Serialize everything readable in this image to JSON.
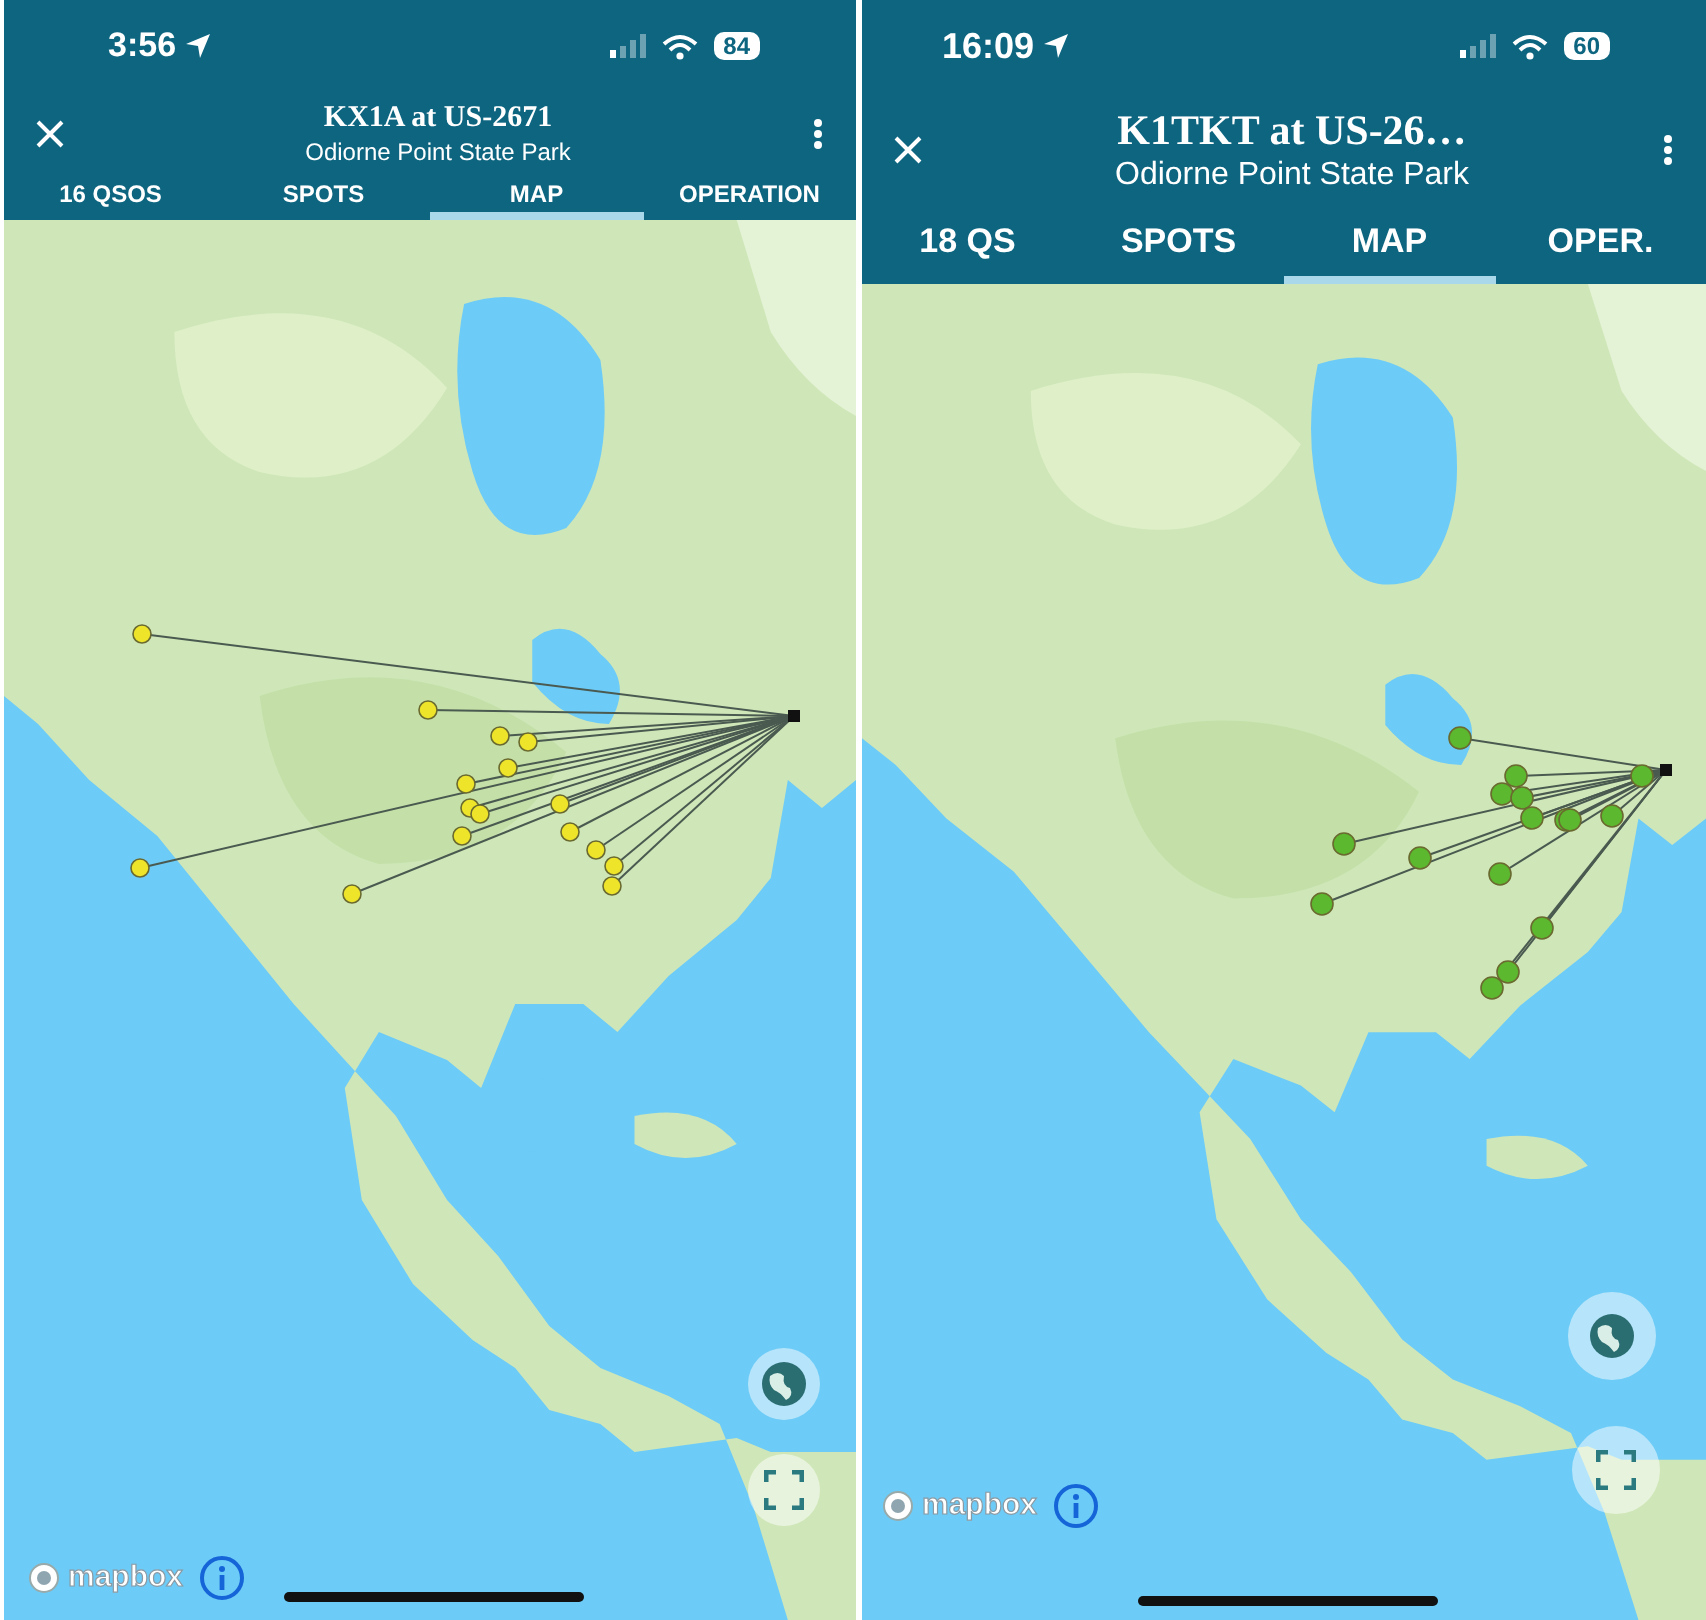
{
  "screens": [
    {
      "status_bar": {
        "time": "3:56",
        "battery": "84"
      },
      "header": {
        "title": "KX1A at US-2671",
        "subtitle": "Odiorne Point State Park"
      },
      "tabs": [
        {
          "label": "16 QSOS",
          "selected": false
        },
        {
          "label": "SPOTS",
          "selected": false
        },
        {
          "label": "MAP",
          "selected": true
        },
        {
          "label": "OPERATION",
          "selected": false
        }
      ],
      "map": {
        "color": "#eee42a",
        "attribution": "mapbox"
      }
    },
    {
      "status_bar": {
        "time": "16:09",
        "battery": "60"
      },
      "header": {
        "title": "K1TKT at US-26…",
        "subtitle": "Odiorne Point State Park"
      },
      "tabs": [
        {
          "label": "18 QS",
          "selected": false
        },
        {
          "label": "SPOTS",
          "selected": false
        },
        {
          "label": "MAP",
          "selected": true
        },
        {
          "label": "OPER.",
          "selected": false
        }
      ],
      "map": {
        "color": "#5cb82e",
        "attribution": "mapbox"
      }
    }
  ]
}
